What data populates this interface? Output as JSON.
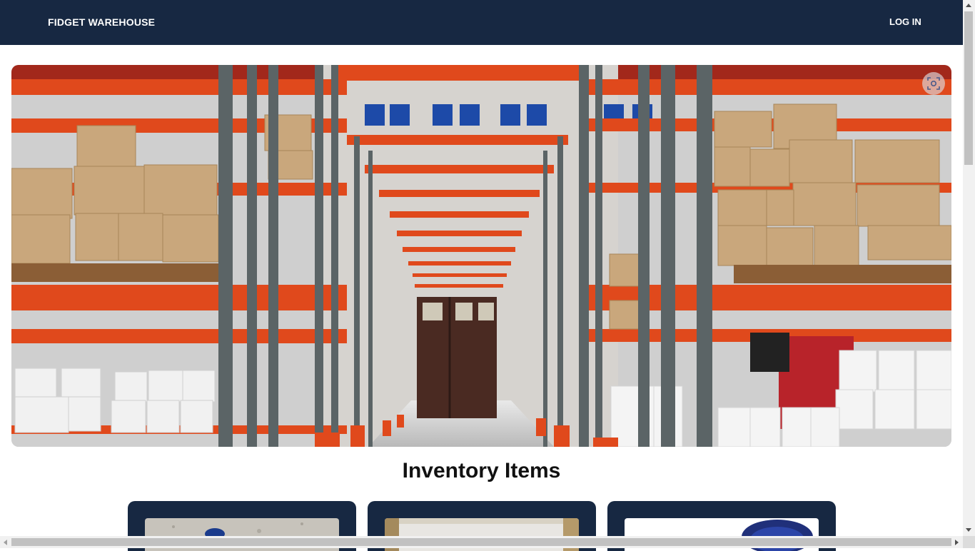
{
  "navbar": {
    "brand": "FIDGET WAREHOUSE",
    "login_label": "LOG IN"
  },
  "hero": {
    "image_icon": "image-search-icon"
  },
  "inventory": {
    "title": "Inventory Items",
    "cards": [
      {
        "image": "caster-wheel-on-concrete"
      },
      {
        "image": "parts-in-box"
      },
      {
        "image": "blue-wheel"
      }
    ]
  },
  "colors": {
    "navbar": "#172842",
    "card": "#172842",
    "shelf_orange": "#e0491c"
  }
}
